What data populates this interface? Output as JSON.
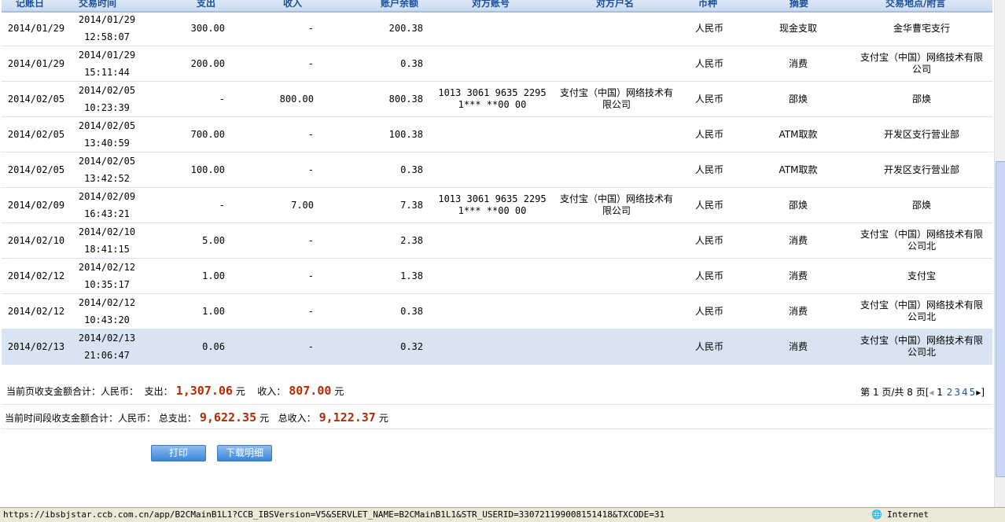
{
  "table": {
    "headers": [
      "记账日",
      "交易时间",
      "支出",
      "收入",
      "账户余额",
      "对方账号",
      "对方户名",
      "币种",
      "摘要",
      "交易地点/附言"
    ],
    "rows": [
      {
        "date": "2014/01/29",
        "tdate": "2014/01/29",
        "ttime": "12:58:07",
        "out": "300.00",
        "in": "-",
        "bal": "200.38",
        "acct": "",
        "name": "",
        "cur": "人民币",
        "memo": "现金支取",
        "place": "金华曹宅支行"
      },
      {
        "date": "2014/01/29",
        "tdate": "2014/01/29",
        "ttime": "15:11:44",
        "out": "200.00",
        "in": "-",
        "bal": "0.38",
        "acct": "",
        "name": "",
        "cur": "人民币",
        "memo": "消费",
        "place": "支付宝（中国）网络技术有限公司"
      },
      {
        "date": "2014/02/05",
        "tdate": "2014/02/05",
        "ttime": "10:23:39",
        "out": "-",
        "in": "800.00",
        "bal": "800.38",
        "acct": "1013 3061 9635 2295 1*** **00 00",
        "name": "支付宝（中国）网络技术有限公司",
        "cur": "人民币",
        "memo": "邵焕",
        "place": "邵焕"
      },
      {
        "date": "2014/02/05",
        "tdate": "2014/02/05",
        "ttime": "13:40:59",
        "out": "700.00",
        "in": "-",
        "bal": "100.38",
        "acct": "",
        "name": "",
        "cur": "人民币",
        "memo": "ATM取款",
        "place": "开发区支行营业部"
      },
      {
        "date": "2014/02/05",
        "tdate": "2014/02/05",
        "ttime": "13:42:52",
        "out": "100.00",
        "in": "-",
        "bal": "0.38",
        "acct": "",
        "name": "",
        "cur": "人民币",
        "memo": "ATM取款",
        "place": "开发区支行营业部"
      },
      {
        "date": "2014/02/09",
        "tdate": "2014/02/09",
        "ttime": "16:43:21",
        "out": "-",
        "in": "7.00",
        "bal": "7.38",
        "acct": "1013 3061 9635 2295 1*** **00 00",
        "name": "支付宝（中国）网络技术有限公司",
        "cur": "人民币",
        "memo": "邵焕",
        "place": "邵焕"
      },
      {
        "date": "2014/02/10",
        "tdate": "2014/02/10",
        "ttime": "18:41:15",
        "out": "5.00",
        "in": "-",
        "bal": "2.38",
        "acct": "",
        "name": "",
        "cur": "人民币",
        "memo": "消费",
        "place": "支付宝（中国）网络技术有限公司北"
      },
      {
        "date": "2014/02/12",
        "tdate": "2014/02/12",
        "ttime": "10:35:17",
        "out": "1.00",
        "in": "-",
        "bal": "1.38",
        "acct": "",
        "name": "",
        "cur": "人民币",
        "memo": "消费",
        "place": "支付宝"
      },
      {
        "date": "2014/02/12",
        "tdate": "2014/02/12",
        "ttime": "10:43:20",
        "out": "1.00",
        "in": "-",
        "bal": "0.38",
        "acct": "",
        "name": "",
        "cur": "人民币",
        "memo": "消费",
        "place": "支付宝（中国）网络技术有限公司北"
      },
      {
        "date": "2014/02/13",
        "tdate": "2014/02/13",
        "ttime": "21:06:47",
        "out": "0.06",
        "in": "-",
        "bal": "0.32",
        "acct": "",
        "name": "",
        "cur": "人民币",
        "memo": "消费",
        "place": "支付宝（中国）网络技术有限公司北"
      }
    ]
  },
  "page_summary": {
    "label": "当前页收支金额合计：人民币：",
    "out_label": "支出：",
    "out": "1,307.06",
    "in_label": "收入：",
    "in": "807.00",
    "unit": "元"
  },
  "period_summary": {
    "label": "当前时间段收支金额合计：人民币：",
    "out_label": "总支出：",
    "out": "9,622.35",
    "in_label": "总收入：",
    "in": "9,122.37",
    "unit": "元"
  },
  "pagination": {
    "text": "第 1 页/共 8 页[",
    "current": "1",
    "pages": [
      "2",
      "3",
      "4",
      "5"
    ],
    "close": "]"
  },
  "buttons": {
    "print": "打印",
    "download": "下载明细"
  },
  "status": {
    "url": "https://ibsbjstar.ccb.com.cn/app/B2CMainB1L1?CCB_IBSVersion=V5&SERVLET_NAME=B2CMainB1L1&STR_USERID=330721199008151418&TXCODE=31",
    "zone": "Internet"
  }
}
